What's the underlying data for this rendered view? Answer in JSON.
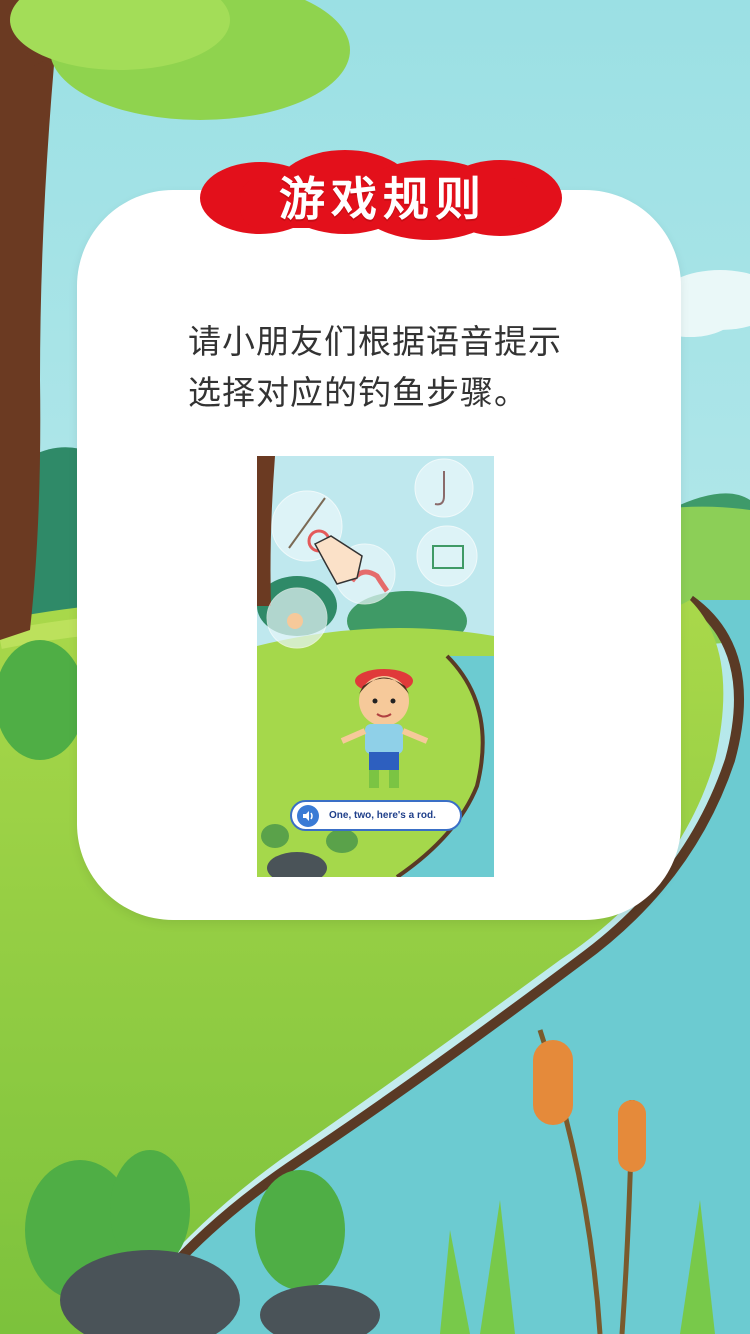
{
  "title": "游戏规则",
  "rules": {
    "line1": "请小朋友们根据语音提示",
    "line2": "选择对应的钓鱼步骤。"
  },
  "preview": {
    "caption": "One, two, here's a rod.",
    "icons": {
      "audio": "speaker-icon",
      "hand": "pointing-hand-icon",
      "rod": "fishing-rod-icon",
      "hook": "fishing-hook-icon",
      "worm": "worm-icon",
      "net": "fishing-net-icon"
    }
  },
  "colors": {
    "badge_red": "#e3101b",
    "sky": "#a8e3e8",
    "grass": "#c6e35a",
    "river": "#69c8cf",
    "card": "#ffffff",
    "caption_blue": "#1f3f8a"
  }
}
